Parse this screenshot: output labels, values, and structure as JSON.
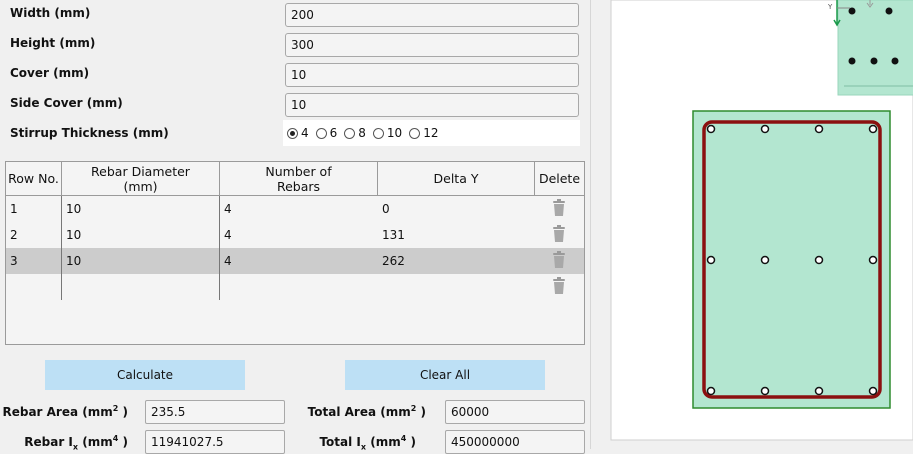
{
  "inputs": {
    "width_label": "Width (mm)",
    "width_value": "200",
    "height_label": "Height (mm)",
    "height_value": "300",
    "cover_label": "Cover (mm)",
    "cover_value": "10",
    "side_cover_label": "Side Cover (mm)",
    "side_cover_value": "10",
    "stirrup_label": "Stirrup Thickness (mm)"
  },
  "stirrup_options": [
    {
      "label": "4",
      "selected": true
    },
    {
      "label": "6",
      "selected": false
    },
    {
      "label": "8",
      "selected": false
    },
    {
      "label": "10",
      "selected": false
    },
    {
      "label": "12",
      "selected": false
    }
  ],
  "table": {
    "headers": [
      "Row No.",
      "Rebar Diameter (mm)",
      "Number of Rebars",
      "Delta Y",
      "Delete"
    ],
    "rows": [
      {
        "row_no": "1",
        "diameter": "10",
        "count": "4",
        "delta_y": "0",
        "selected": false
      },
      {
        "row_no": "2",
        "diameter": "10",
        "count": "4",
        "delta_y": "131",
        "selected": false
      },
      {
        "row_no": "3",
        "diameter": "10",
        "count": "4",
        "delta_y": "262",
        "selected": true
      }
    ]
  },
  "buttons": {
    "calculate": "Calculate",
    "clear_all": "Clear All"
  },
  "results": {
    "rebar_area_label": "Rebar Area (mm",
    "rebar_area_value": "235.5",
    "rebar_ix_label": "Rebar I",
    "rebar_ix_value": "11941027.5",
    "total_area_label": "Total Area (mm",
    "total_area_value": "60000",
    "total_ix_label": "Total I",
    "total_ix_value": "450000000",
    "sub_x": "x",
    "sup_2": "2",
    "sup_4": "4",
    "unit_mm": " (mm",
    "close": " )"
  },
  "canvas": {
    "axis_label_y": "Y",
    "section_fill": "#b3e6d0",
    "stirrup_color": "#8b1010",
    "border_color": "#2e8b2e"
  }
}
